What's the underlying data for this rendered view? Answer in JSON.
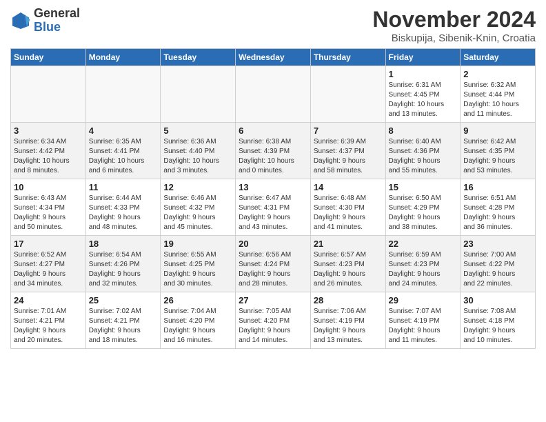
{
  "header": {
    "logo_general": "General",
    "logo_blue": "Blue",
    "month_title": "November 2024",
    "location": "Biskupija, Sibenik-Knin, Croatia"
  },
  "weekdays": [
    "Sunday",
    "Monday",
    "Tuesday",
    "Wednesday",
    "Thursday",
    "Friday",
    "Saturday"
  ],
  "weeks": [
    [
      {
        "day": "",
        "info": ""
      },
      {
        "day": "",
        "info": ""
      },
      {
        "day": "",
        "info": ""
      },
      {
        "day": "",
        "info": ""
      },
      {
        "day": "",
        "info": ""
      },
      {
        "day": "1",
        "info": "Sunrise: 6:31 AM\nSunset: 4:45 PM\nDaylight: 10 hours\nand 13 minutes."
      },
      {
        "day": "2",
        "info": "Sunrise: 6:32 AM\nSunset: 4:44 PM\nDaylight: 10 hours\nand 11 minutes."
      }
    ],
    [
      {
        "day": "3",
        "info": "Sunrise: 6:34 AM\nSunset: 4:42 PM\nDaylight: 10 hours\nand 8 minutes."
      },
      {
        "day": "4",
        "info": "Sunrise: 6:35 AM\nSunset: 4:41 PM\nDaylight: 10 hours\nand 6 minutes."
      },
      {
        "day": "5",
        "info": "Sunrise: 6:36 AM\nSunset: 4:40 PM\nDaylight: 10 hours\nand 3 minutes."
      },
      {
        "day": "6",
        "info": "Sunrise: 6:38 AM\nSunset: 4:39 PM\nDaylight: 10 hours\nand 0 minutes."
      },
      {
        "day": "7",
        "info": "Sunrise: 6:39 AM\nSunset: 4:37 PM\nDaylight: 9 hours\nand 58 minutes."
      },
      {
        "day": "8",
        "info": "Sunrise: 6:40 AM\nSunset: 4:36 PM\nDaylight: 9 hours\nand 55 minutes."
      },
      {
        "day": "9",
        "info": "Sunrise: 6:42 AM\nSunset: 4:35 PM\nDaylight: 9 hours\nand 53 minutes."
      }
    ],
    [
      {
        "day": "10",
        "info": "Sunrise: 6:43 AM\nSunset: 4:34 PM\nDaylight: 9 hours\nand 50 minutes."
      },
      {
        "day": "11",
        "info": "Sunrise: 6:44 AM\nSunset: 4:33 PM\nDaylight: 9 hours\nand 48 minutes."
      },
      {
        "day": "12",
        "info": "Sunrise: 6:46 AM\nSunset: 4:32 PM\nDaylight: 9 hours\nand 45 minutes."
      },
      {
        "day": "13",
        "info": "Sunrise: 6:47 AM\nSunset: 4:31 PM\nDaylight: 9 hours\nand 43 minutes."
      },
      {
        "day": "14",
        "info": "Sunrise: 6:48 AM\nSunset: 4:30 PM\nDaylight: 9 hours\nand 41 minutes."
      },
      {
        "day": "15",
        "info": "Sunrise: 6:50 AM\nSunset: 4:29 PM\nDaylight: 9 hours\nand 38 minutes."
      },
      {
        "day": "16",
        "info": "Sunrise: 6:51 AM\nSunset: 4:28 PM\nDaylight: 9 hours\nand 36 minutes."
      }
    ],
    [
      {
        "day": "17",
        "info": "Sunrise: 6:52 AM\nSunset: 4:27 PM\nDaylight: 9 hours\nand 34 minutes."
      },
      {
        "day": "18",
        "info": "Sunrise: 6:54 AM\nSunset: 4:26 PM\nDaylight: 9 hours\nand 32 minutes."
      },
      {
        "day": "19",
        "info": "Sunrise: 6:55 AM\nSunset: 4:25 PM\nDaylight: 9 hours\nand 30 minutes."
      },
      {
        "day": "20",
        "info": "Sunrise: 6:56 AM\nSunset: 4:24 PM\nDaylight: 9 hours\nand 28 minutes."
      },
      {
        "day": "21",
        "info": "Sunrise: 6:57 AM\nSunset: 4:23 PM\nDaylight: 9 hours\nand 26 minutes."
      },
      {
        "day": "22",
        "info": "Sunrise: 6:59 AM\nSunset: 4:23 PM\nDaylight: 9 hours\nand 24 minutes."
      },
      {
        "day": "23",
        "info": "Sunrise: 7:00 AM\nSunset: 4:22 PM\nDaylight: 9 hours\nand 22 minutes."
      }
    ],
    [
      {
        "day": "24",
        "info": "Sunrise: 7:01 AM\nSunset: 4:21 PM\nDaylight: 9 hours\nand 20 minutes."
      },
      {
        "day": "25",
        "info": "Sunrise: 7:02 AM\nSunset: 4:21 PM\nDaylight: 9 hours\nand 18 minutes."
      },
      {
        "day": "26",
        "info": "Sunrise: 7:04 AM\nSunset: 4:20 PM\nDaylight: 9 hours\nand 16 minutes."
      },
      {
        "day": "27",
        "info": "Sunrise: 7:05 AM\nSunset: 4:20 PM\nDaylight: 9 hours\nand 14 minutes."
      },
      {
        "day": "28",
        "info": "Sunrise: 7:06 AM\nSunset: 4:19 PM\nDaylight: 9 hours\nand 13 minutes."
      },
      {
        "day": "29",
        "info": "Sunrise: 7:07 AM\nSunset: 4:19 PM\nDaylight: 9 hours\nand 11 minutes."
      },
      {
        "day": "30",
        "info": "Sunrise: 7:08 AM\nSunset: 4:18 PM\nDaylight: 9 hours\nand 10 minutes."
      }
    ]
  ]
}
